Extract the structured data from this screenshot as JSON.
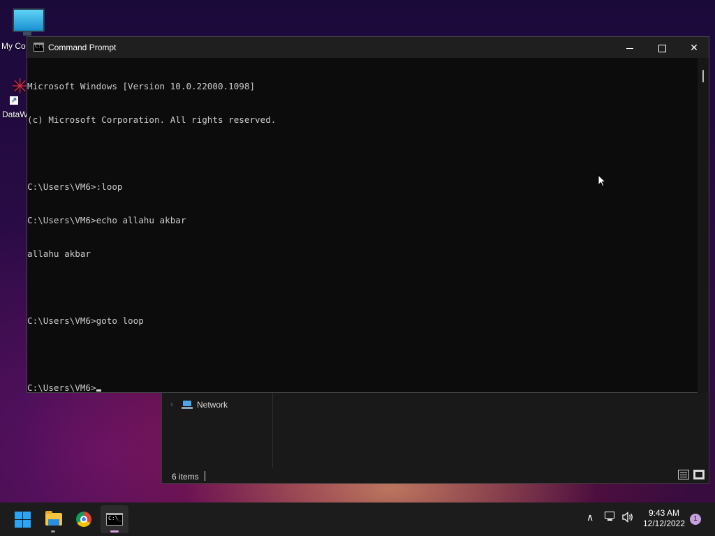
{
  "desktop": {
    "icons": [
      {
        "label": "My Co"
      },
      {
        "label": "DataW"
      }
    ]
  },
  "explorer": {
    "nav_item": "Network",
    "status_text": "6 items"
  },
  "cmd": {
    "title": "Command Prompt",
    "icon_text": "C:\\",
    "lines": [
      "Microsoft Windows [Version 10.0.22000.1098]",
      "(c) Microsoft Corporation. All rights reserved.",
      "",
      "C:\\Users\\VM6>:loop",
      "C:\\Users\\VM6>echo allahu akbar",
      "allahu akbar",
      "",
      "C:\\Users\\VM6>goto loop",
      "",
      "C:\\Users\\VM6>"
    ],
    "controls": {
      "minimize": "minimize",
      "maximize": "maximize",
      "close": "✕"
    }
  },
  "taskbar": {
    "apps": [
      "start",
      "file-explorer",
      "chrome",
      "command-prompt"
    ],
    "cmd_icon_text": "C:\\_",
    "tray": {
      "chevron": "∧",
      "volume": "🔊",
      "time": "9:43 AM",
      "date": "12/12/2022",
      "notification_count": "1"
    }
  },
  "colors": {
    "console_bg": "#0c0c0c",
    "console_text": "#cccccc",
    "titlebar": "#1f1f1f",
    "taskbar": "#1c1c1c",
    "accent": "#28a5f5"
  }
}
